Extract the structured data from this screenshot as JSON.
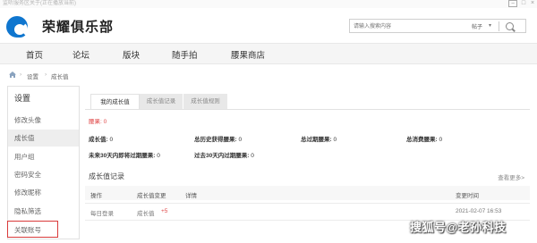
{
  "top_strip": {
    "text": "监听服务区关于(正在播放当前)"
  },
  "header": {
    "site_name": "荣耀俱乐部",
    "search": {
      "placeholder": "请输入搜索内容",
      "scope": "帖子"
    }
  },
  "nav": {
    "items": [
      "首页",
      "论坛",
      "版块",
      "随手拍",
      "腰果商店"
    ]
  },
  "breadcrumb": {
    "items": [
      "设置",
      "成长值"
    ]
  },
  "sidebar": {
    "title": "设置",
    "items": [
      "修改头像",
      "成长值",
      "用户组",
      "密码安全",
      "修改昵称",
      "隐私筛选",
      "关联账号"
    ],
    "active": "成长值",
    "highlighted": "关联账号",
    "highlight_color": "#d93a3a"
  },
  "main": {
    "tabs": [
      "我的成长值",
      "成长值记录",
      "成长值规则"
    ],
    "active_tab": "我的成长值",
    "total_label": "腰果: ",
    "total_value": "0",
    "stats": [
      {
        "label": "成长值:",
        "value": "0"
      },
      {
        "label": "总历史获得腰果:",
        "value": "0"
      },
      {
        "label": "总过期腰果:",
        "value": "0"
      },
      {
        "label": "总消费腰果:",
        "value": "0"
      },
      {
        "label": "未来30天内即将过期腰果:",
        "value": "0"
      },
      {
        "label": "过去30天内过期腰果:",
        "value": "0"
      }
    ],
    "records": {
      "title": "成长值记录",
      "view_more": "查看更多>",
      "columns": [
        "操作",
        "成长值变更",
        "详情",
        "变更时间"
      ],
      "rows": [
        {
          "action": "每日登录",
          "change_label": "成长值",
          "change_value": "+5",
          "detail": "",
          "time": "2021-02-07 16:53"
        }
      ]
    }
  },
  "watermark": "搜狐号@老孙科技",
  "colors": {
    "accent": "#0f76cf",
    "plus": "#e04a4a",
    "highlight": "#d93a3a"
  }
}
